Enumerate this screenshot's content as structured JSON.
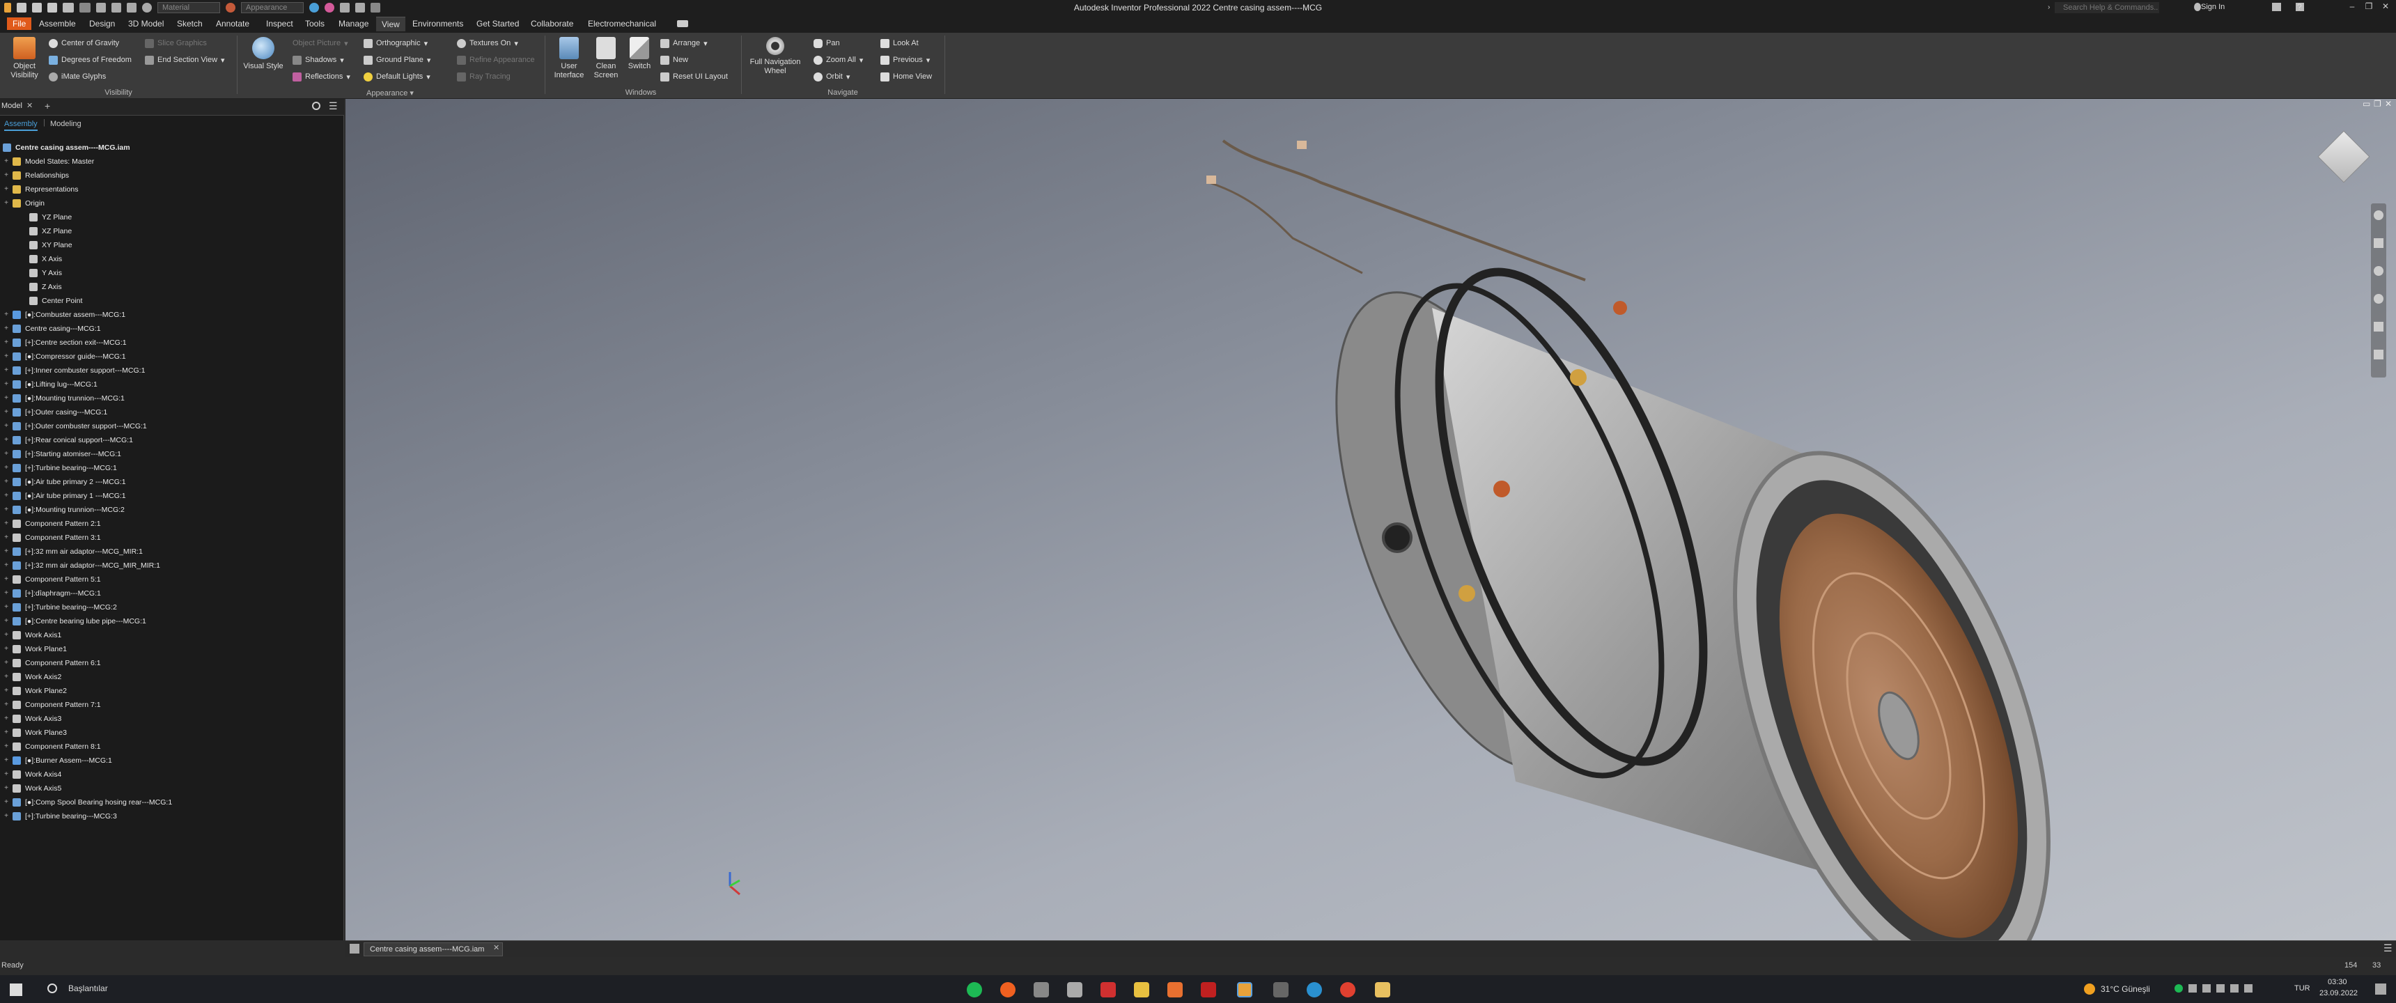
{
  "app": {
    "title": "Autodesk Inventor Professional 2022   Centre casing assem----MCG",
    "material_select": "Material",
    "appearance_select": "Appearance",
    "search_placeholder": "Search Help & Commands...",
    "sign_in": "Sign In"
  },
  "menu_tabs": [
    "File",
    "Assemble",
    "Design",
    "3D Model",
    "Sketch",
    "Annotate",
    "Inspect",
    "Tools",
    "Manage",
    "View",
    "Environments",
    "Get Started",
    "Collaborate",
    "Electromechanical"
  ],
  "ribbon": {
    "visibility": {
      "object_visibility": "Object Visibility",
      "center_of_gravity": "Center of Gravity",
      "degrees_of_freedom": "Degrees of Freedom",
      "imate_glyphs": "iMate Glyphs",
      "slice_graphics": "Slice Graphics",
      "end_section_view": "End Section View",
      "label": "Visibility"
    },
    "appearance": {
      "visual_style": "Visual Style",
      "shadows": "Shadows",
      "reflections": "Reflections",
      "orthographic": "Orthographic",
      "ground_plane": "Ground Plane",
      "default_lights": "Default Lights",
      "textures_on": "Textures On",
      "refine_appearance": "Refine Appearance",
      "ray_tracing": "Ray Tracing",
      "object_picture": "Object Picture",
      "label": "Appearance"
    },
    "windows": {
      "user_interface": "User Interface",
      "clean_screen": "Clean Screen",
      "switch": "Switch",
      "arrange": "Arrange",
      "new": "New",
      "reset_ui_layout": "Reset UI Layout",
      "label": "Windows"
    },
    "navigate": {
      "full_navigation_wheel": "Full Navigation Wheel",
      "pan": "Pan",
      "zoom_all": "Zoom All",
      "orbit": "Orbit",
      "look_at": "Look At",
      "previous": "Previous",
      "home_view": "Home View",
      "label": "Navigate"
    }
  },
  "browser": {
    "tab": "Model",
    "subtab_assembly": "Assembly",
    "subtab_modeling": "Modeling",
    "root": "Centre casing assem----MCG.iam",
    "items": [
      {
        "label": "Model States: Master",
        "icon": "folder"
      },
      {
        "label": "Relationships",
        "icon": "folder"
      },
      {
        "label": "Representations",
        "icon": "folder"
      },
      {
        "label": "Origin",
        "icon": "folder"
      },
      {
        "label": "YZ Plane",
        "icon": "plane",
        "indent": 1
      },
      {
        "label": "XZ Plane",
        "icon": "plane",
        "indent": 1
      },
      {
        "label": "XY Plane",
        "icon": "plane",
        "indent": 1
      },
      {
        "label": "X Axis",
        "icon": "axis",
        "indent": 1
      },
      {
        "label": "Y Axis",
        "icon": "axis",
        "indent": 1
      },
      {
        "label": "Z Axis",
        "icon": "axis",
        "indent": 1
      },
      {
        "label": "Center Point",
        "icon": "point",
        "indent": 1
      },
      {
        "label": "[●]:Combuster assem---MCG:1",
        "icon": "asm"
      },
      {
        "label": "Centre casing---MCG:1",
        "icon": "part"
      },
      {
        "label": "[+]:Centre section exit---MCG:1",
        "icon": "part"
      },
      {
        "label": "[●]:Compressor guide---MCG:1",
        "icon": "part"
      },
      {
        "label": "[+]:Inner combuster support---MCG:1",
        "icon": "part"
      },
      {
        "label": "[●]:Lifting lug---MCG:1",
        "icon": "part"
      },
      {
        "label": "[●]:Mounting trunnion---MCG:1",
        "icon": "part"
      },
      {
        "label": "[+]:Outer casing---MCG:1",
        "icon": "part"
      },
      {
        "label": "[+]:Outer combuster support---MCG:1",
        "icon": "part"
      },
      {
        "label": "[+]:Rear conical support---MCG:1",
        "icon": "part"
      },
      {
        "label": "[+]:Starting atomiser---MCG:1",
        "icon": "part"
      },
      {
        "label": "[+]:Turbine bearing---MCG:1",
        "icon": "part"
      },
      {
        "label": "[●]:Air tube primary 2 ---MCG:1",
        "icon": "part"
      },
      {
        "label": "[●]:Air tube primary 1 ---MCG:1",
        "icon": "part"
      },
      {
        "label": "[●]:Mounting trunnion---MCG:2",
        "icon": "part"
      },
      {
        "label": "Component Pattern 2:1",
        "icon": "pattern"
      },
      {
        "label": "Component Pattern 3:1",
        "icon": "pattern"
      },
      {
        "label": "[+]:32 mm air adaptor---MCG_MIR:1",
        "icon": "part"
      },
      {
        "label": "[+]:32 mm air adaptor---MCG_MIR_MIR:1",
        "icon": "part"
      },
      {
        "label": "Component Pattern 5:1",
        "icon": "pattern"
      },
      {
        "label": "[+]:dîaphragm---MCG:1",
        "icon": "part"
      },
      {
        "label": "[+]:Turbine bearing---MCG:2",
        "icon": "part"
      },
      {
        "label": "[●]:Centre bearing lube pipe---MCG:1",
        "icon": "part"
      },
      {
        "label": "Work Axis1",
        "icon": "axis"
      },
      {
        "label": "Work Plane1",
        "icon": "plane"
      },
      {
        "label": "Component Pattern 6:1",
        "icon": "pattern"
      },
      {
        "label": "Work Axis2",
        "icon": "axis"
      },
      {
        "label": "Work Plane2",
        "icon": "plane"
      },
      {
        "label": "Component Pattern 7:1",
        "icon": "pattern"
      },
      {
        "label": "Work Axis3",
        "icon": "axis"
      },
      {
        "label": "Work Plane3",
        "icon": "plane"
      },
      {
        "label": "Component Pattern 8:1",
        "icon": "pattern"
      },
      {
        "label": "[●]:Burner Assem---MCG:1",
        "icon": "asm"
      },
      {
        "label": "Work Axis4",
        "icon": "axis"
      },
      {
        "label": "Work Axis5",
        "icon": "axis"
      },
      {
        "label": "[●]:Comp Spool Bearing hosing rear---MCG:1",
        "icon": "part"
      },
      {
        "label": "[+]:Turbine bearing---MCG:3",
        "icon": "part"
      }
    ]
  },
  "document_tab": "Centre casing assem----MCG.iam",
  "status": {
    "text": "Ready",
    "count_a": "154",
    "count_b": "33"
  },
  "taskbar": {
    "search": "Başlantılar",
    "weather": "31°C  Güneşli",
    "lang": "TUR",
    "time": "03:30",
    "date": "23.09.2022"
  },
  "colors": {
    "file_tab": "#e05a1a",
    "ribbon_bg": "#3b3b3b",
    "browser_bg": "#1b1b1b",
    "selected_subtab": "#4a9fd8"
  }
}
